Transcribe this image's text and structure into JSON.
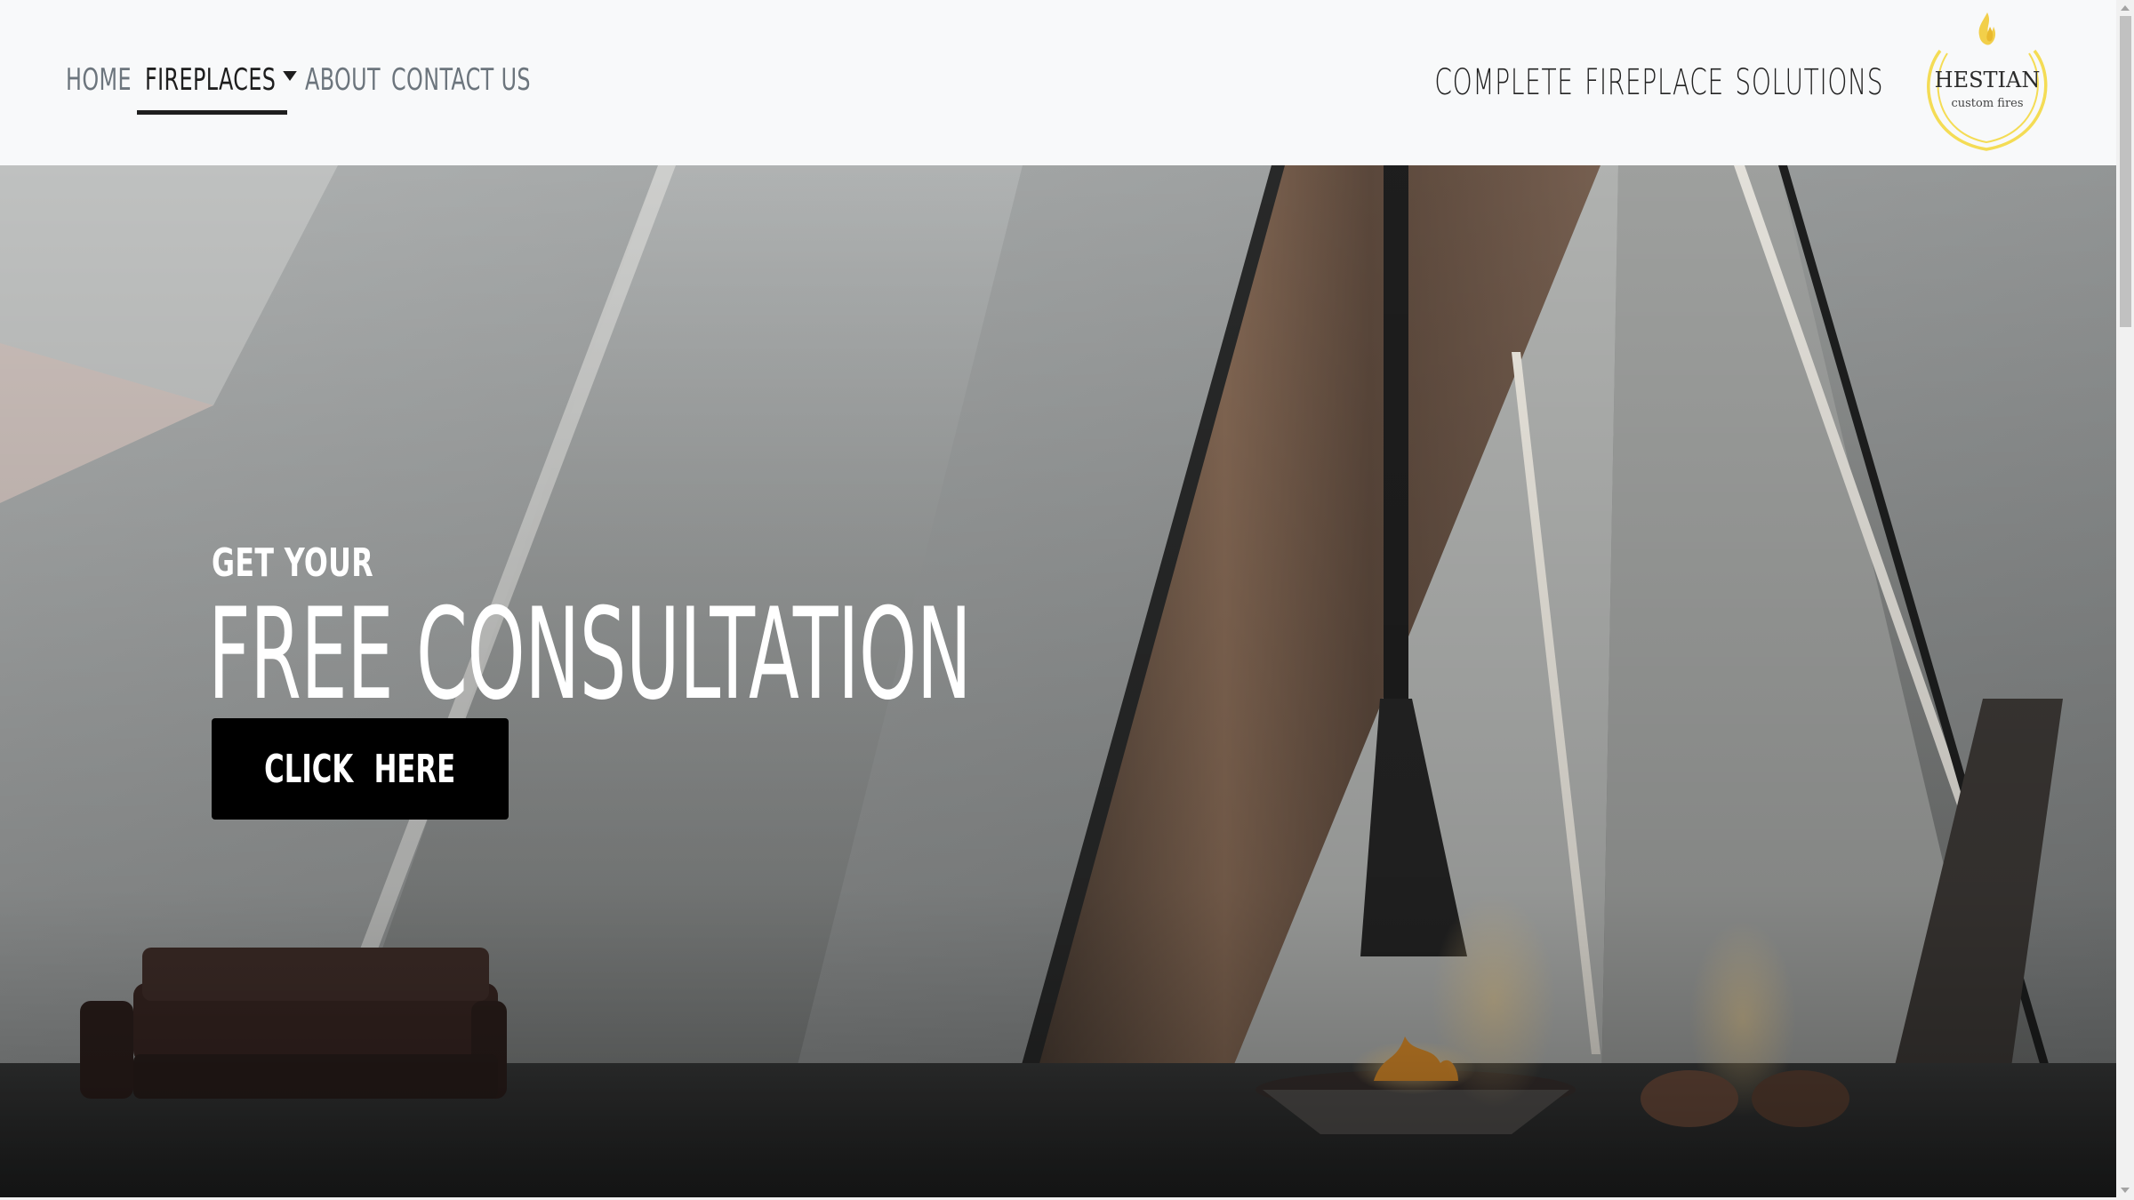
{
  "nav": {
    "items": [
      {
        "label": "Home",
        "active": false
      },
      {
        "label": "Fireplaces",
        "active": true,
        "dropdown": true
      },
      {
        "label": "About",
        "active": false
      },
      {
        "label": "Contact Us",
        "active": false
      }
    ]
  },
  "header": {
    "tagline": "COMPLETE FIREPLACE SOLUTIONS",
    "logo": {
      "name": "HESTIAN",
      "subtitle": "custom fires",
      "accent_color": "#f2d54a",
      "icon": "flame-icon"
    }
  },
  "hero": {
    "eyebrow": "GET YOUR",
    "headline": "FREE CONSULTATION",
    "cta_label": "CLICK HERE"
  },
  "colors": {
    "navbar_bg": "#f8f9fa",
    "nav_text": "#6c757d",
    "nav_active": "#1e1e1e",
    "cta_bg": "#000000",
    "hero_text": "#ffffff"
  }
}
